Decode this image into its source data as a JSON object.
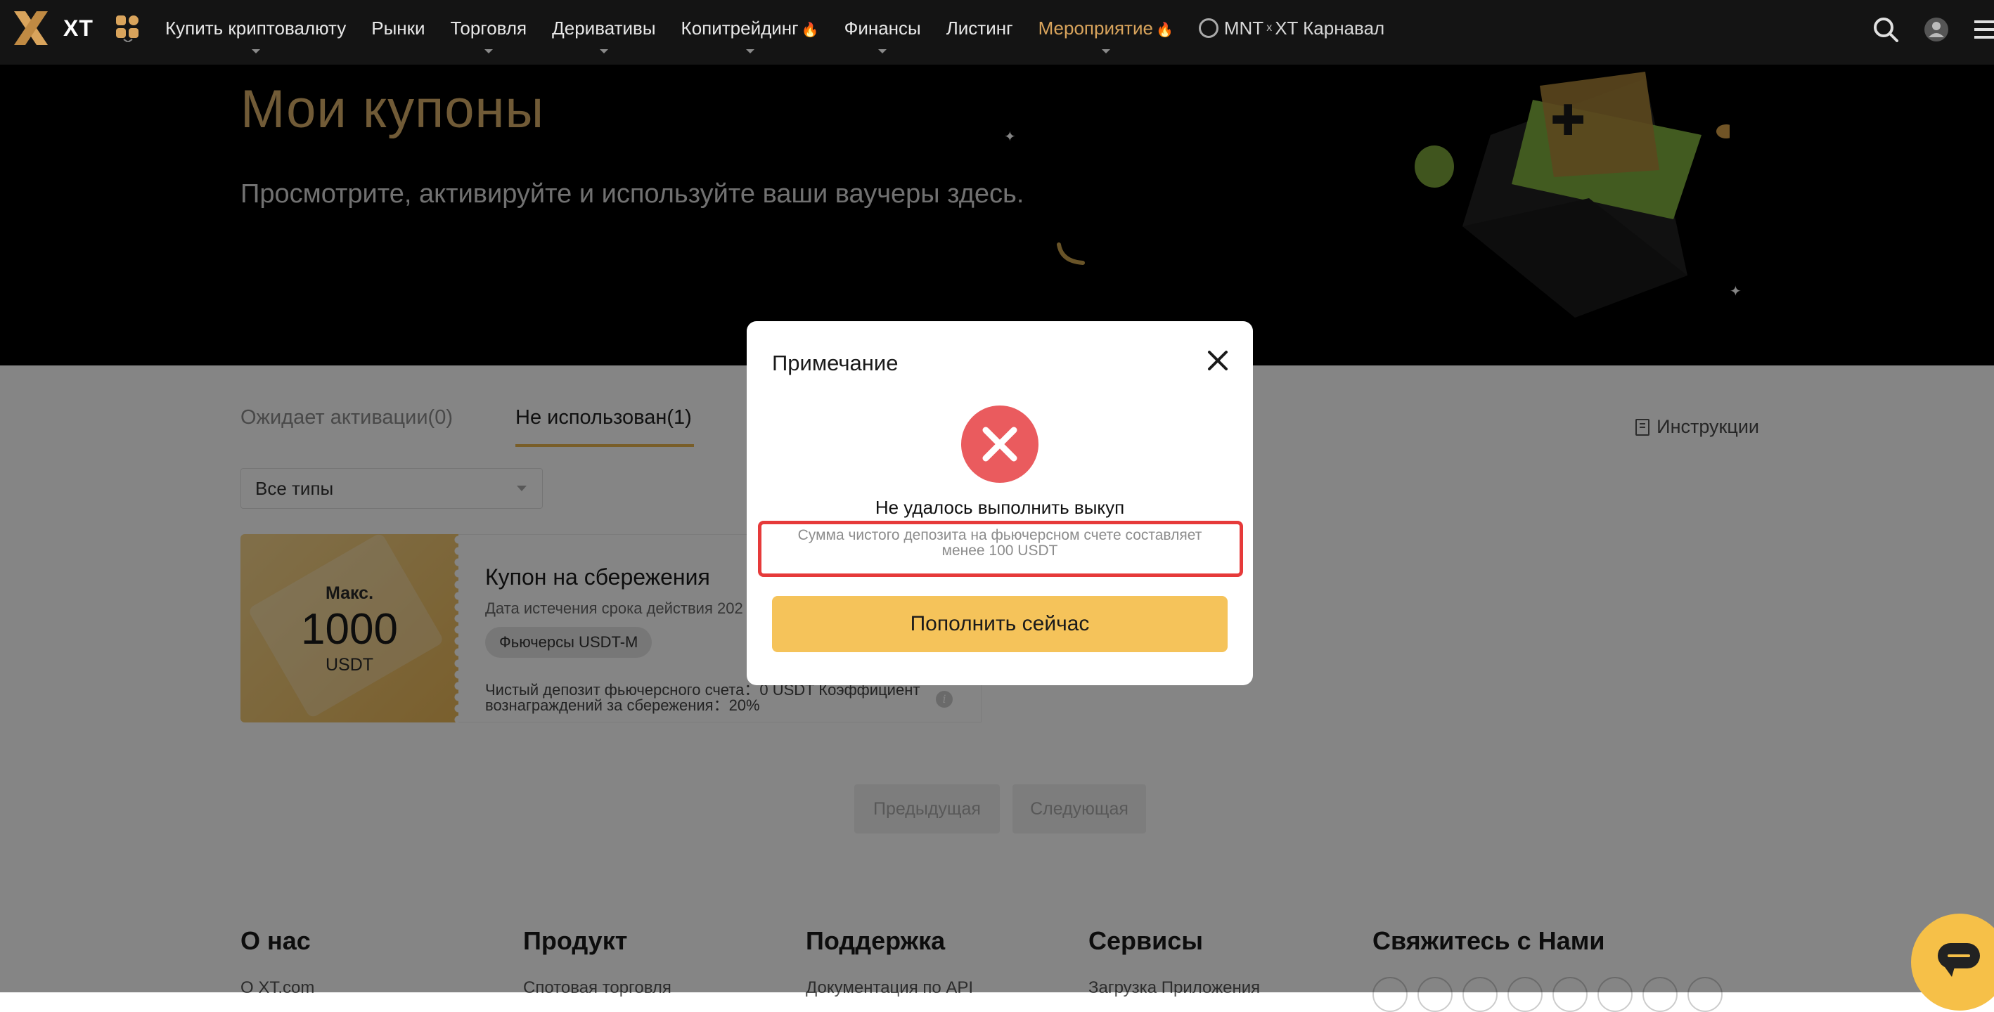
{
  "nav": {
    "logo_text": "XT",
    "items": [
      {
        "label": "Купить криптовалюту",
        "has_caret": true,
        "fire": false
      },
      {
        "label": "Рынки",
        "has_caret": false,
        "fire": false
      },
      {
        "label": "Торговля",
        "has_caret": true,
        "fire": false
      },
      {
        "label": "Деривативы",
        "has_caret": true,
        "fire": false
      },
      {
        "label": "Копитрейдинг",
        "has_caret": true,
        "fire": true
      },
      {
        "label": "Финансы",
        "has_caret": true,
        "fire": false
      },
      {
        "label": "Листинг",
        "has_caret": false,
        "fire": false
      },
      {
        "label": "Мероприятие",
        "has_caret": true,
        "fire": true,
        "accent": true
      }
    ],
    "mnt_label": "MNT",
    "mnt_sep": "x",
    "mnt_suffix": "XT Карнавал",
    "icons": [
      "search-icon",
      "user-icon",
      "menu-icon"
    ]
  },
  "hero": {
    "title": "Мои купоны",
    "subtitle": "Просмотрите, активируйте и используйте ваши ваучеры здесь."
  },
  "tabs": [
    {
      "label": "Ожидает активации(0)",
      "active": false
    },
    {
      "label": "Не использован(1)",
      "active": true
    }
  ],
  "instructions_label": "Инструкции",
  "filter": {
    "selected": "Все типы"
  },
  "coupon": {
    "max_label": "Макс.",
    "amount": "1000",
    "unit": "USDT",
    "title": "Купон на сбережения",
    "expiry": "Дата истечения срока действия 202",
    "tag": "Фьючерсы USDT-M",
    "stats": "Чистый депозит фьючерсного счета：0 USDT  Коэффициент вознаграждений за сбережения：20%"
  },
  "pagination": {
    "prev": "Предыдущая",
    "next": "Следующая"
  },
  "footer": {
    "columns": [
      {
        "title": "О нас",
        "first": "О XT.com"
      },
      {
        "title": "Продукт",
        "first": "Спотовая торговля"
      },
      {
        "title": "Поддержка",
        "first": "Документация по API"
      },
      {
        "title": "Сервисы",
        "first": "Загрузка Приложения"
      },
      {
        "title": "Свяжитесь с Нами",
        "first": ""
      }
    ]
  },
  "modal": {
    "title": "Примечание",
    "heading": "Не удалось выполнить выкуп",
    "description": "Сумма чистого депозита на фьючерсном счете составляет менее 100 USDT",
    "button": "Пополнить сейчас",
    "error_color": "#ea5b5e",
    "button_color": "#f5c35a",
    "highlight_color": "#e63a3a"
  },
  "colors": {
    "accent_gold": "#d9ae6a",
    "topbar_bg": "#141414",
    "tab_underline": "#e8b54d"
  }
}
